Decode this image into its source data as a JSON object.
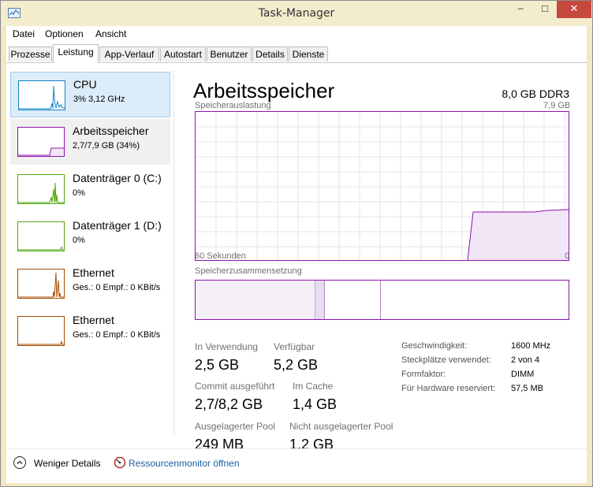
{
  "window": {
    "title": "Task-Manager",
    "close_glyph": "✕",
    "minimize_glyph": "─",
    "maximize_glyph": "☐"
  },
  "menu": [
    "Datei",
    "Optionen",
    "Ansicht"
  ],
  "tabs": [
    "Prozesse",
    "Leistung",
    "App-Verlauf",
    "Autostart",
    "Benutzer",
    "Details",
    "Dienste"
  ],
  "active_tab": "Leistung",
  "sidebar": [
    {
      "name": "CPU",
      "sub": "3% 3,12 GHz",
      "color": "#1183c8",
      "icon": "cpu-graph-thumbnail"
    },
    {
      "name": "Arbeitsspeicher",
      "sub": "2,7/7,9 GB (34%)",
      "color": "#8b12ae",
      "icon": "memory-graph-thumbnail"
    },
    {
      "name": "Datenträger 0 (C:)",
      "sub": "0%",
      "color": "#4da60c",
      "icon": "disk-graph-thumbnail"
    },
    {
      "name": "Datenträger 1 (D:)",
      "sub": "0%",
      "color": "#4da60c",
      "icon": "disk-graph-thumbnail"
    },
    {
      "name": "Ethernet",
      "sub": "Ges.: 0  Empf.: 0 KBit/s",
      "color": "#a74f01",
      "icon": "ethernet-graph-thumbnail"
    },
    {
      "name": "Ethernet",
      "sub": "Ges.: 0  Empf.: 0 KBit/s",
      "color": "#a74f01",
      "icon": "ethernet-graph-thumbnail"
    }
  ],
  "detail": {
    "title": "Arbeitsspeicher",
    "spec": "8,0 GB DDR3",
    "usage_label": "Speicherauslastung",
    "usage_max": "7,9 GB",
    "time_label": "60 Sekunden",
    "time_end": "0",
    "composition_label": "Speicherzusammensetzung",
    "accent": "#8b12ae",
    "stats": [
      {
        "label": "In Verwendung",
        "value": "2,5 GB"
      },
      {
        "label": "Verfügbar",
        "value": "5,2 GB"
      },
      {
        "label": "Commit ausgeführt",
        "value": "2,7/8,2 GB"
      },
      {
        "label": "Im Cache",
        "value": "1,4 GB"
      },
      {
        "label": "Ausgelagerter Pool",
        "value": "249 MB"
      },
      {
        "label": "Nicht ausgelagerter Pool",
        "value": "1,2 GB"
      }
    ],
    "info": [
      {
        "key": "Geschwindigkeit:",
        "value": "1600 MHz"
      },
      {
        "key": "Steckplätze verwendet:",
        "value": "2 von 4"
      },
      {
        "key": "Formfaktor:",
        "value": "DIMM"
      },
      {
        "key": "Für Hardware reserviert:",
        "value": "57,5 MB"
      }
    ]
  },
  "footer": {
    "fewer_details": "Weniger Details",
    "resource_monitor": "Ressourcenmonitor öffnen",
    "fewer_icon": "chevron-up-icon",
    "resmon_icon": "resource-monitor-icon"
  }
}
